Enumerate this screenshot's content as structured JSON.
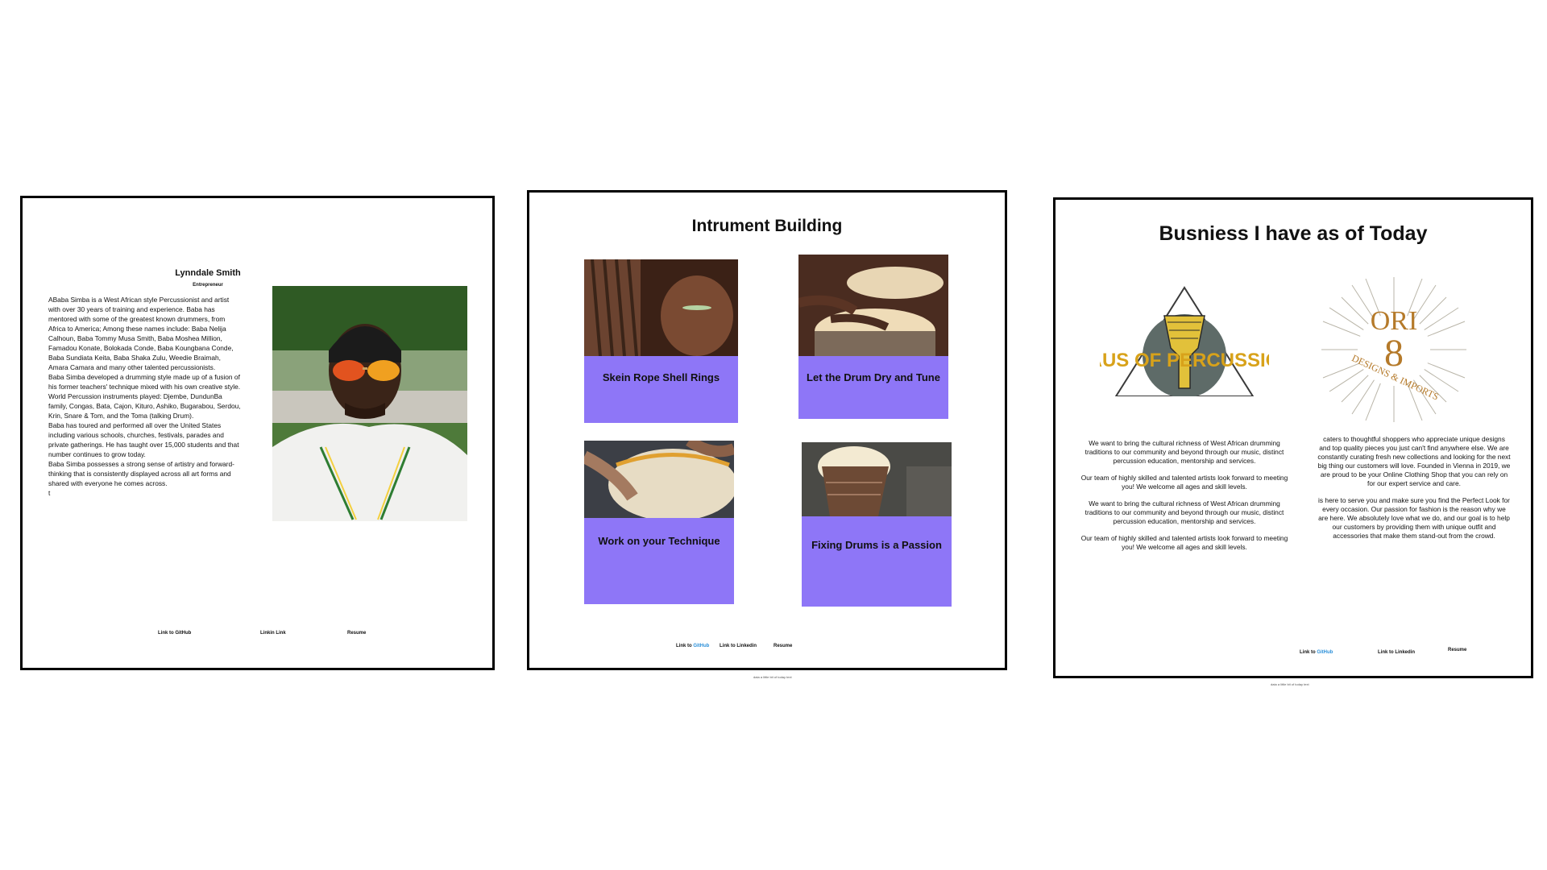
{
  "profile": {
    "name": "Lynndale Smith",
    "role": "Entrepreneur",
    "bio": [
      "ABaba Simba is a West African style Percussionist and artist with over 30 years of training and experience. Baba has mentored with some of the greatest known drummers, from Africa to America; Among these names include: Baba Nelija Calhoun, Baba Tommy Musa Smith, Baba Moshea Million, Famadou Konate, Bolokada Conde, Baba Koungbana Conde, Baba Sundiata Keita, Baba Shaka Zulu, Weedie Braimah, Amara Camara and many other talented percussionists.",
      "Baba Simba developed a drumming style made up of a fusion of his former teachers' technique mixed with his own creative style. World Percussion instruments played: Djembe, DundunBa family, Congas, Bata, Cajon, Kituro, Ashiko, Bugarabou, Serdou, Krin, Snare & Tom, and the Toma (talking Drum).",
      "Baba has toured and performed all over the United States including various schools, churches, festivals, parades and private gatherings. He has taught over 15,000 students and that number continues to grow today.",
      "Baba Simba possesses a strong sense of artistry and forward-thinking that is consistently displayed across all art forms and shared with everyone he comes across.",
      "t"
    ],
    "links": {
      "github": "Link to GitHub",
      "linkedin": "Linkin Link",
      "resume": "Resume"
    },
    "portrait_icon": "person-photo"
  },
  "instrument": {
    "title": "Intrument Building",
    "cards": [
      {
        "caption": "Skein Rope Shell Rings"
      },
      {
        "caption": "Let the Drum Dry and Tune"
      },
      {
        "caption": "Work on your Technique"
      },
      {
        "caption": "Fixing Drums is a Passion"
      }
    ],
    "links": {
      "prefix": "Link to ",
      "github": "GitHub",
      "linkedin": "Link to Linkedin",
      "resume": "Resume"
    },
    "footer": "data a little bit of today text"
  },
  "business": {
    "title": "Busniess I have as of  Today",
    "logo1_text": "HAUS OF PERCUSSION",
    "logo2_text_top": "ORI",
    "logo2_text_mid": "8",
    "logo2_text_bottom": "DESIGNS & IMPORTS",
    "left_text": [
      "We want to bring the cultural richness of West African drumming traditions to our community and beyond through our music, distinct percussion education, mentorship and services.",
      "Our team of highly skilled and talented artists look forward to meeting you! We welcome all ages and skill levels.",
      "We want to bring the cultural richness of West African drumming traditions to our community and beyond through our music, distinct percussion education, mentorship and services.",
      "Our team of highly skilled and talented artists look forward to meeting you! We welcome all ages and skill levels."
    ],
    "right_text": [
      "caters to thoughtful shoppers who appreciate unique designs and top quality pieces you just can't find anywhere else. We are constantly curating fresh new collections and looking for the next big thing our customers will love. Founded in Vienna in 2019, we are proud to be your Online Clothing Shop that you can rely on for our expert service and care.",
      "is here to serve you and make sure you find the Perfect Look for every occasion. Our passion for fashion is the reason why we are here. We absolutely love what we do, and our goal is to help our customers by providing them with unique outfit and accessories that make them stand-out from the crowd."
    ],
    "links": {
      "prefix": "Link to ",
      "github": "GitHub",
      "linkedin": "Link to Linkedin",
      "resume": "Resume"
    },
    "footer": "data a little bit of today text"
  },
  "colors": {
    "card_purple": "#8e76f7",
    "logo_gold": "#d8a21a",
    "logo_slate": "#5e6b68",
    "link_blue": "#2a8fd9"
  }
}
